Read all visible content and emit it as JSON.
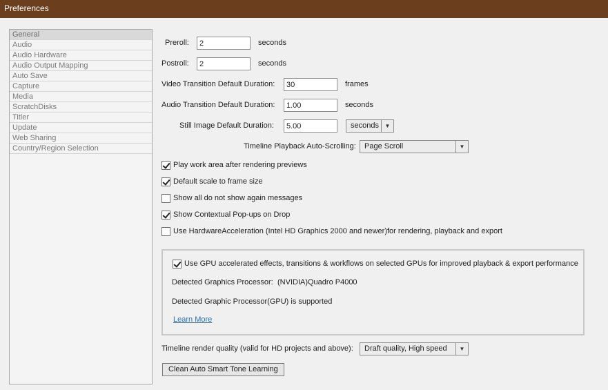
{
  "window": {
    "title": "Preferences"
  },
  "sidebar": {
    "items": [
      {
        "label": "General",
        "selected": true
      },
      {
        "label": "Audio"
      },
      {
        "label": "Audio Hardware"
      },
      {
        "label": "Audio Output Mapping"
      },
      {
        "label": "Auto Save"
      },
      {
        "label": "Capture"
      },
      {
        "label": "Media"
      },
      {
        "label": "ScratchDisks"
      },
      {
        "label": "Titler"
      },
      {
        "label": "Update"
      },
      {
        "label": "Web Sharing"
      },
      {
        "label": "Country/Region Selection"
      }
    ]
  },
  "general": {
    "preroll": {
      "label": "Preroll:",
      "value": "2",
      "unit": "seconds"
    },
    "postroll": {
      "label": "Postroll:",
      "value": "2",
      "unit": "seconds"
    },
    "video_transition": {
      "label": "Video Transition Default Duration:",
      "value": "30",
      "unit": "frames"
    },
    "audio_transition": {
      "label": "Audio Transition Default Duration:",
      "value": "1.00",
      "unit": "seconds"
    },
    "still_image": {
      "label": "Still Image Default Duration:",
      "value": "5.00",
      "unit_selected": "seconds"
    },
    "timeline_scroll": {
      "label": "Timeline Playback Auto-Scrolling:",
      "selected": "Page Scroll"
    },
    "checkboxes": [
      {
        "label": "Play work area after rendering previews",
        "checked": true
      },
      {
        "label": "Default scale to frame size",
        "checked": true
      },
      {
        "label": "Show all do not show again messages",
        "checked": false
      },
      {
        "label": "Show Contextual Pop-ups on Drop",
        "checked": true
      },
      {
        "label": "Use HardwareAcceleration (Intel HD Graphics 2000 and newer)for rendering, playback and export",
        "checked": false
      }
    ],
    "gpu": {
      "checkbox_label": "Use GPU accelerated effects, transitions & workflows on selected GPUs for improved playback & export performance",
      "checked": true,
      "detected_label": "Detected Graphics Processor:",
      "detected_value": "(NVIDIA)Quadro P4000",
      "supported_text": "Detected Graphic Processor(GPU) is supported",
      "learn_more": "Learn More"
    },
    "render_quality": {
      "label": "Timeline render quality (valid for HD projects and above):",
      "selected": "Draft quality, High speed"
    },
    "clean_button": "Clean Auto Smart Tone Learning"
  }
}
